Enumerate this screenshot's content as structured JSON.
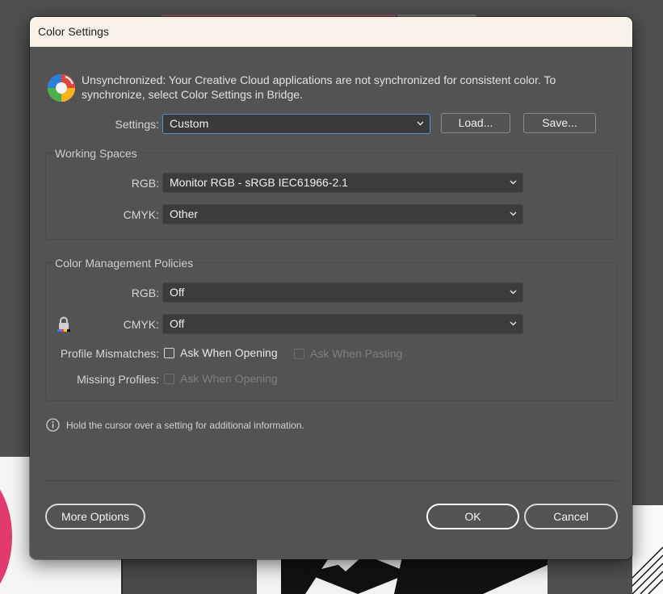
{
  "dialog": {
    "title": "Color Settings",
    "sync_message": "Unsynchronized: Your Creative Cloud applications are not synchronized for consistent color. To synchronize, select Color Settings in Bridge.",
    "settings": {
      "label": "Settings:",
      "value": "Custom",
      "load_label": "Load...",
      "save_label": "Save..."
    },
    "working_spaces": {
      "title": "Working Spaces",
      "rgb_label": "RGB:",
      "rgb_value": "Monitor RGB - sRGB IEC61966-2.1",
      "cmyk_label": "CMYK:",
      "cmyk_value": "Other"
    },
    "policies": {
      "title": "Color Management Policies",
      "rgb_label": "RGB:",
      "rgb_value": "Off",
      "cmyk_label": "CMYK:",
      "cmyk_value": "Off",
      "mismatch_label": "Profile Mismatches:",
      "mismatch_opening": "Ask When Opening",
      "mismatch_pasting": "Ask When Pasting",
      "missing_label": "Missing Profiles:",
      "missing_opening": "Ask When Opening"
    },
    "info_text": "Hold the cursor over a setting for additional information.",
    "more_options_label": "More Options",
    "ok_label": "OK",
    "cancel_label": "Cancel"
  },
  "icons": {
    "sync": "color-sync-icon",
    "lock": "lock-icon",
    "info": "info-icon",
    "dropdown": "chevron-down-icon"
  },
  "colors": {
    "dialog_bg": "#535353",
    "titlebar_bg": "#f8f2e9",
    "focus_border": "#5c8ed6"
  }
}
